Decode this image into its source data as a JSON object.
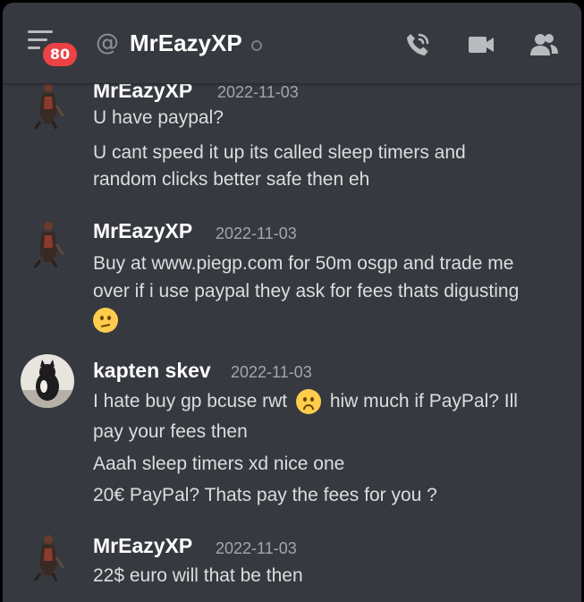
{
  "header": {
    "unread_count": "80",
    "at_symbol": "@",
    "title": "MrEazyXP",
    "status": "offline",
    "icons": [
      "menu-icon",
      "call-icon",
      "video-icon",
      "members-icon"
    ]
  },
  "messages": [
    {
      "author": "MrEazyXP",
      "timestamp": "2022-11-03",
      "lines": [
        "U have paypal?",
        "U cant speed it up its called sleep timers and",
        "random clicks better safe then eh"
      ]
    },
    {
      "author": "MrEazyXP",
      "timestamp": "2022-11-03",
      "lines": [
        "Buy at www.piegp.com for 50m osgp and trade me",
        "over if i use paypal they ask for fees thats digusting"
      ],
      "emoji": "confused-face"
    },
    {
      "author": "kapten skev",
      "timestamp": "2022-11-03",
      "lines": [
        "I hate buy gp bcuse rwt",
        "hiw much if PayPal? Ill",
        "pay your fees then",
        "Aaah sleep timers xd nice one",
        "20€ PayPal? Thats pay the fees for you ?"
      ],
      "emoji": "frowning-face"
    },
    {
      "author": "MrEazyXP",
      "timestamp": "2022-11-03",
      "lines": [
        "22$ euro will that be then"
      ]
    }
  ],
  "colors": {
    "background": "#36393f",
    "badge": "#ed4245",
    "text": "#dcddde",
    "muted": "#a3a6aa"
  }
}
